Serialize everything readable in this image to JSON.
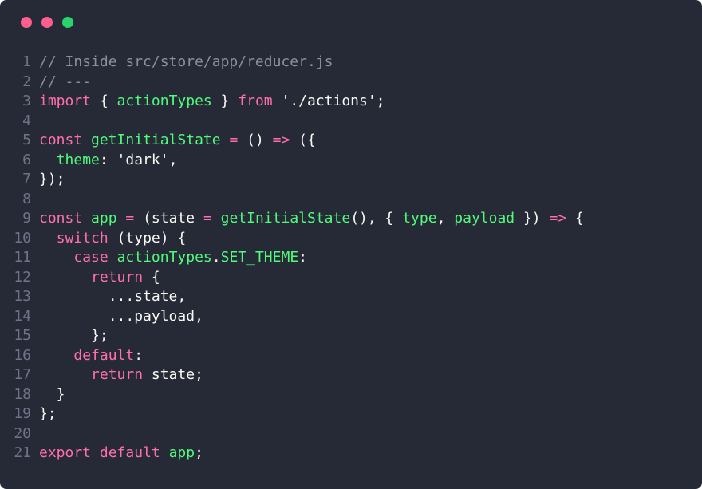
{
  "window": {
    "background": "#262a36",
    "controls": [
      {
        "name": "close",
        "color": "#ff5f8f"
      },
      {
        "name": "minimize",
        "color": "#ff5f8f"
      },
      {
        "name": "zoom",
        "color": "#2bd46a"
      }
    ]
  },
  "code": {
    "language": "javascript",
    "lines": [
      {
        "n": "1",
        "tokens": [
          {
            "t": "// Inside src/store/app/reducer.js",
            "c": "comment"
          }
        ]
      },
      {
        "n": "2",
        "tokens": [
          {
            "t": "// ---",
            "c": "comment"
          }
        ]
      },
      {
        "n": "3",
        "tokens": [
          {
            "t": "import",
            "c": "keyword"
          },
          {
            "t": " { ",
            "c": "punct"
          },
          {
            "t": "actionTypes",
            "c": "ident"
          },
          {
            "t": " } ",
            "c": "punct"
          },
          {
            "t": "from",
            "c": "keyword"
          },
          {
            "t": " './actions';",
            "c": "string"
          }
        ]
      },
      {
        "n": "4",
        "tokens": []
      },
      {
        "n": "5",
        "tokens": [
          {
            "t": "const",
            "c": "keyword"
          },
          {
            "t": " ",
            "c": "plain"
          },
          {
            "t": "getInitialState",
            "c": "ident"
          },
          {
            "t": " ",
            "c": "plain"
          },
          {
            "t": "=",
            "c": "op"
          },
          {
            "t": " () ",
            "c": "punct"
          },
          {
            "t": "=>",
            "c": "op"
          },
          {
            "t": " ({",
            "c": "punct"
          }
        ]
      },
      {
        "n": "6",
        "tokens": [
          {
            "t": "  ",
            "c": "plain"
          },
          {
            "t": "theme",
            "c": "prop"
          },
          {
            "t": ": 'dark',",
            "c": "string"
          }
        ]
      },
      {
        "n": "7",
        "tokens": [
          {
            "t": "});",
            "c": "punct"
          }
        ]
      },
      {
        "n": "8",
        "tokens": []
      },
      {
        "n": "9",
        "tokens": [
          {
            "t": "const",
            "c": "keyword"
          },
          {
            "t": " ",
            "c": "plain"
          },
          {
            "t": "app",
            "c": "ident"
          },
          {
            "t": " ",
            "c": "plain"
          },
          {
            "t": "=",
            "c": "op"
          },
          {
            "t": " (state ",
            "c": "punct"
          },
          {
            "t": "=",
            "c": "op"
          },
          {
            "t": " ",
            "c": "plain"
          },
          {
            "t": "getInitialState",
            "c": "ident"
          },
          {
            "t": "(), { ",
            "c": "punct"
          },
          {
            "t": "type",
            "c": "ident"
          },
          {
            "t": ", ",
            "c": "punct"
          },
          {
            "t": "payload",
            "c": "ident"
          },
          {
            "t": " }) ",
            "c": "punct"
          },
          {
            "t": "=>",
            "c": "op"
          },
          {
            "t": " {",
            "c": "punct"
          }
        ]
      },
      {
        "n": "10",
        "tokens": [
          {
            "t": "  ",
            "c": "plain"
          },
          {
            "t": "switch",
            "c": "keyword"
          },
          {
            "t": " (type) {",
            "c": "punct"
          }
        ]
      },
      {
        "n": "11",
        "tokens": [
          {
            "t": "    ",
            "c": "plain"
          },
          {
            "t": "case",
            "c": "keyword"
          },
          {
            "t": " ",
            "c": "plain"
          },
          {
            "t": "actionTypes",
            "c": "ident"
          },
          {
            "t": ".",
            "c": "punct"
          },
          {
            "t": "SET_THEME",
            "c": "ident"
          },
          {
            "t": ":",
            "c": "punct"
          }
        ]
      },
      {
        "n": "12",
        "tokens": [
          {
            "t": "      ",
            "c": "plain"
          },
          {
            "t": "return",
            "c": "keyword"
          },
          {
            "t": " {",
            "c": "punct"
          }
        ]
      },
      {
        "n": "13",
        "tokens": [
          {
            "t": "        ...state,",
            "c": "plain"
          }
        ]
      },
      {
        "n": "14",
        "tokens": [
          {
            "t": "        ...payload,",
            "c": "plain"
          }
        ]
      },
      {
        "n": "15",
        "tokens": [
          {
            "t": "      };",
            "c": "punct"
          }
        ]
      },
      {
        "n": "16",
        "tokens": [
          {
            "t": "    ",
            "c": "plain"
          },
          {
            "t": "default",
            "c": "keyword"
          },
          {
            "t": ":",
            "c": "punct"
          }
        ]
      },
      {
        "n": "17",
        "tokens": [
          {
            "t": "      ",
            "c": "plain"
          },
          {
            "t": "return",
            "c": "keyword"
          },
          {
            "t": " state;",
            "c": "plain"
          }
        ]
      },
      {
        "n": "18",
        "tokens": [
          {
            "t": "  }",
            "c": "punct"
          }
        ]
      },
      {
        "n": "19",
        "tokens": [
          {
            "t": "};",
            "c": "punct"
          }
        ]
      },
      {
        "n": "20",
        "tokens": []
      },
      {
        "n": "21",
        "tokens": [
          {
            "t": "export",
            "c": "keyword"
          },
          {
            "t": " ",
            "c": "plain"
          },
          {
            "t": "default",
            "c": "keyword"
          },
          {
            "t": " ",
            "c": "plain"
          },
          {
            "t": "app",
            "c": "ident"
          },
          {
            "t": ";",
            "c": "punct"
          }
        ]
      }
    ]
  }
}
